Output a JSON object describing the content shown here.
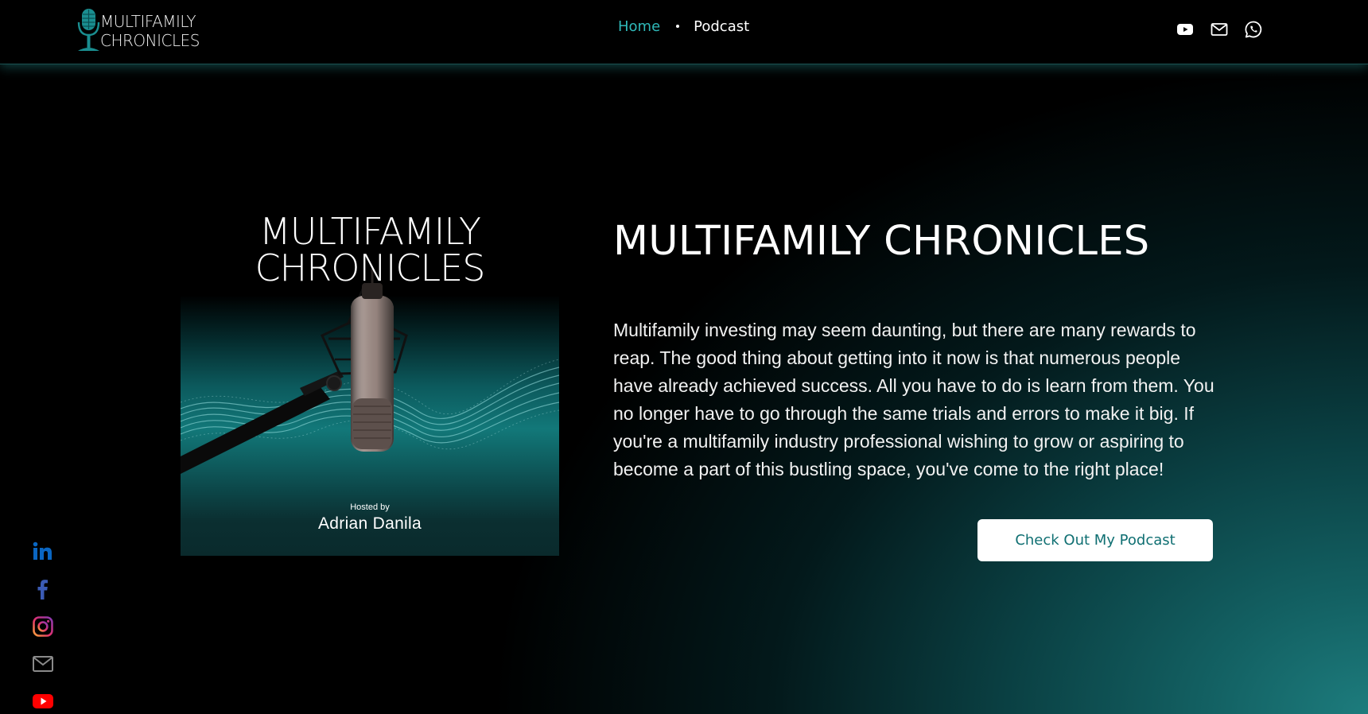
{
  "brand": {
    "logo_line1": "MULTIFAMILY",
    "logo_line2": "CHRONICLES",
    "accent_color": "#2fb9b9"
  },
  "nav": {
    "items": [
      {
        "label": "Home",
        "active": true
      },
      {
        "label": "Podcast",
        "active": false
      }
    ]
  },
  "header_social": [
    "youtube-icon",
    "mail-icon",
    "whatsapp-icon"
  ],
  "side_social": [
    "linkedin-icon",
    "facebook-icon",
    "instagram-icon",
    "mail-icon",
    "youtube-icon"
  ],
  "cover": {
    "title_line1": "MULTIFAMILY",
    "title_line2": "CHRONICLES",
    "hosted_by": "Hosted by",
    "host_name": "Adrian Danila"
  },
  "hero": {
    "title": "MULTIFAMILY CHRONICLES",
    "body": "Multifamily investing may seem daunting, but there are many rewards to reap. The good thing about getting into it now is that numerous people have already achieved success. All you have to do is learn from them. You no longer have to go through the same trials and errors to make it big. If you're a multifamily industry professional wishing to grow or aspiring to become a part of this bustling space, you've come to the right place!",
    "cta_label": "Check Out My Podcast"
  }
}
